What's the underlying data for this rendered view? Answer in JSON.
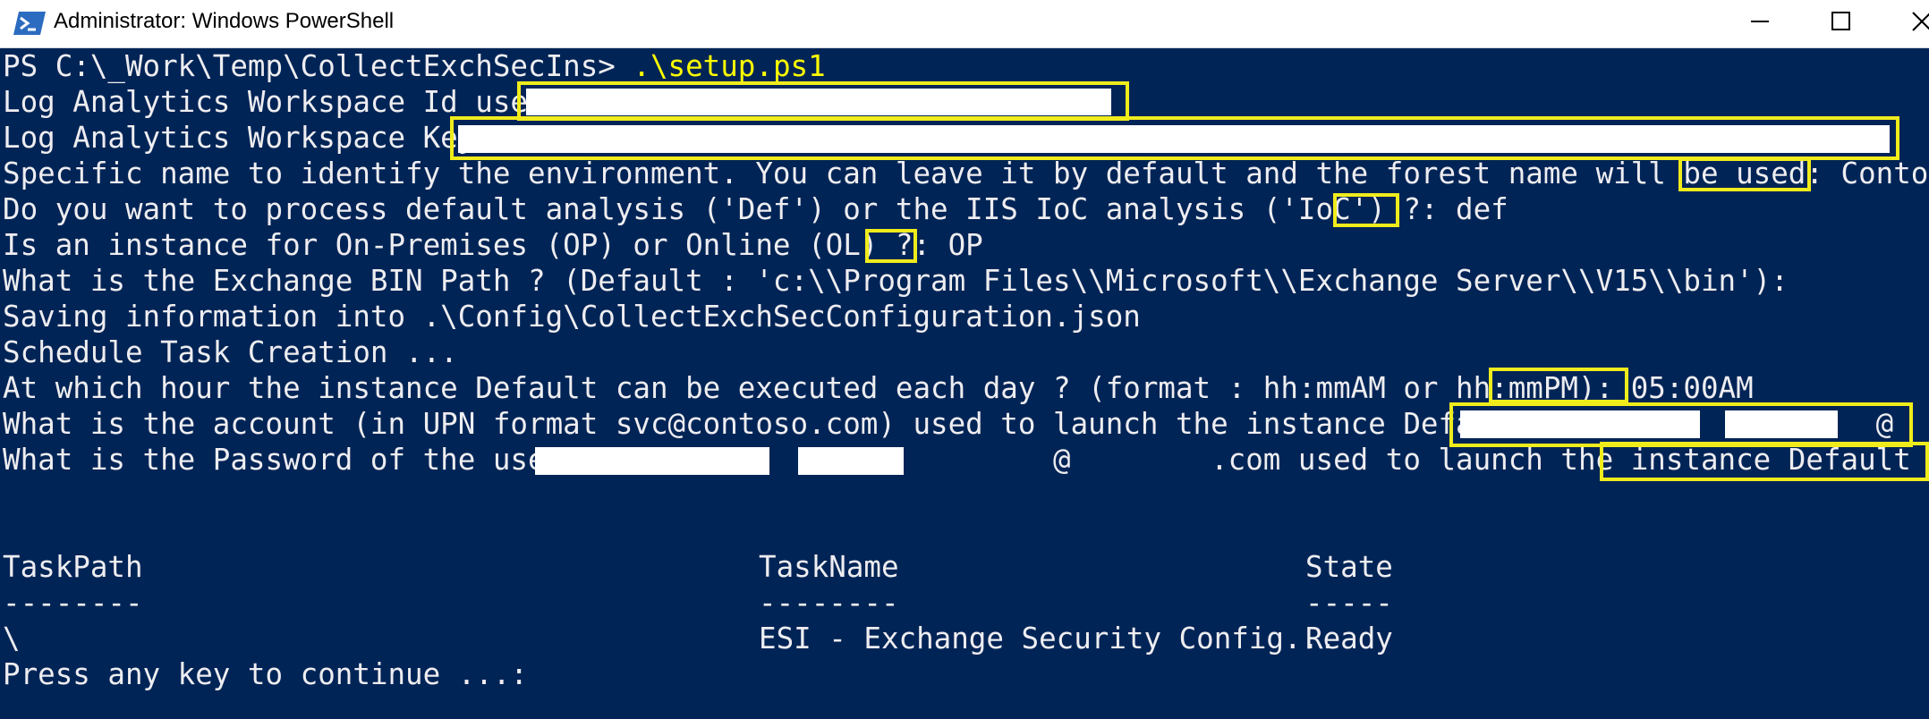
{
  "window": {
    "title": "Administrator: Windows PowerShell",
    "icon": "powershell-icon"
  },
  "console": {
    "prompt": "PS C:\\_Work\\Temp\\CollectExchSecIns> ",
    "command": ".\\setup.ps1",
    "lines": [
      "Log Analytics Workspace Id used:",
      "Log Analytics Workspace Key:",
      "Specific name to identify the environment. You can leave it by default and the forest name will be used: Contoso",
      "Do you want to process default analysis ('Def') or the IIS IoC analysis ('IoC') ?: def",
      "Is an instance for On-Premises (OP) or Online (OL) ?: OP",
      "What is the Exchange BIN Path ? (Default : 'c:\\\\Program Files\\\\Microsoft\\\\Exchange Server\\\\V15\\\\bin'):",
      "Saving information into .\\Config\\CollectExchSecConfiguration.json",
      "Schedule Task Creation ...",
      "At which hour the instance Default can be executed each day ? (format : hh:mmAM or hh:mmPM): 05:00AM",
      "What is the account (in UPN format svc@contoso.com) used to launch the instance Default ?:                 @        .com",
      "What is the Password of the user                            @        .com used to launch the instance Default ?: *********************"
    ],
    "table": {
      "headers": [
        "TaskPath",
        "TaskName",
        "State"
      ],
      "separators": [
        "--------",
        "--------",
        "-----"
      ],
      "rows": [
        [
          "\\",
          "ESI - Exchange Security Config...",
          "Ready"
        ]
      ]
    },
    "footer": "Press any key to continue ...:"
  },
  "colors": {
    "background": "#012456",
    "text": "#eeedf0",
    "command": "#fdfd00",
    "highlight": "#f0ec1c",
    "redaction": "#ffffff"
  }
}
